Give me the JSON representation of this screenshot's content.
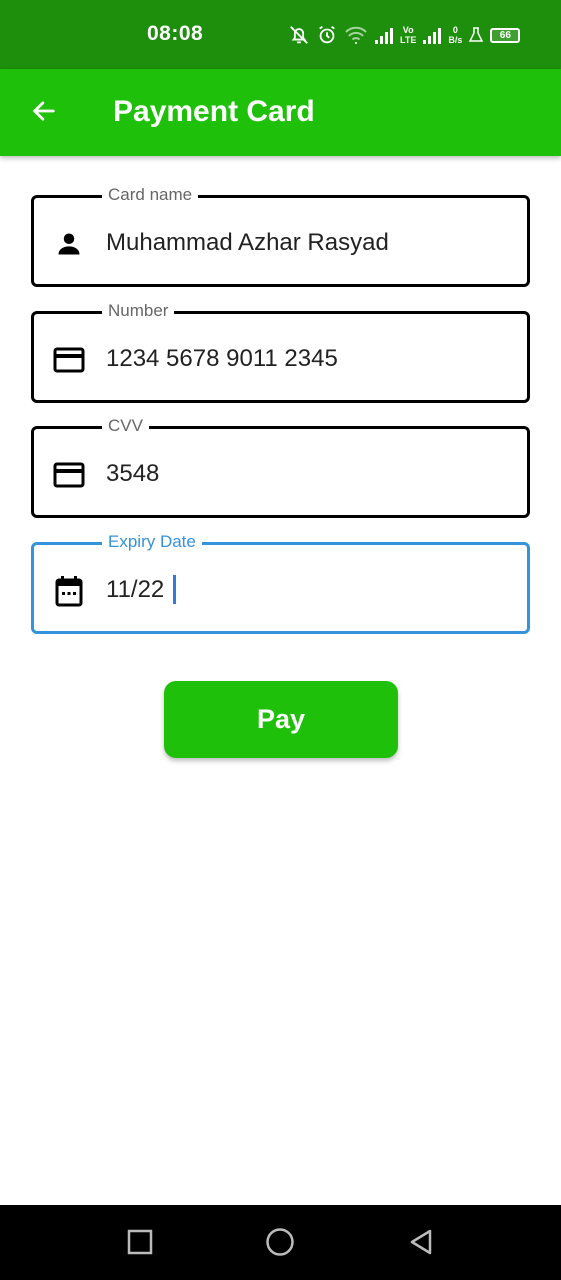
{
  "status_bar": {
    "time": "08:08",
    "network_top": "Vo",
    "network_bottom": "LTE",
    "speed_value": "0",
    "speed_unit": "B/s",
    "battery": "66"
  },
  "app_bar": {
    "title": "Payment Card",
    "color": "#1fc00a"
  },
  "form": {
    "card_name": {
      "label": "Card name",
      "value": "Muhammad Azhar Rasyad",
      "icon": "person-icon"
    },
    "number": {
      "label": "Number",
      "value": "1234 5678 9011 2345",
      "icon": "credit-card-icon"
    },
    "cvv": {
      "label": "CVV",
      "value": "3548",
      "icon": "credit-card-icon"
    },
    "expiry": {
      "label": "Expiry Date",
      "value": "11/22",
      "icon": "calendar-icon",
      "focused": true,
      "focus_color": "#3393dc"
    }
  },
  "pay_button": {
    "label": "Pay"
  },
  "nav_bar": {
    "items": [
      "recents-button",
      "home-button",
      "back-button"
    ]
  }
}
